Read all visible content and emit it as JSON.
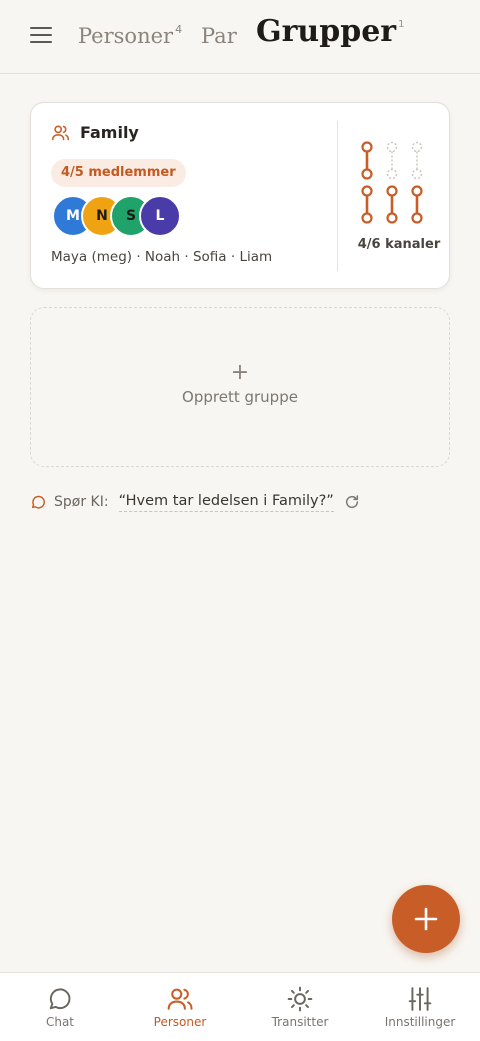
{
  "header": {
    "tabs": [
      {
        "label": "Personer",
        "count": "4"
      },
      {
        "label": "Par",
        "count": ""
      },
      {
        "label": "Grupper",
        "count": "1"
      }
    ],
    "active_tab": "Grupper"
  },
  "group_card": {
    "name": "Family",
    "badge": "4/5 medlemmer",
    "avatars": [
      {
        "initial": "M",
        "color": "#2f7ad6"
      },
      {
        "initial": "N",
        "color": "#f0a312"
      },
      {
        "initial": "S",
        "color": "#1fa36a"
      },
      {
        "initial": "L",
        "color": "#4a3ca8"
      }
    ],
    "members": "Maya (meg) · Noah · Sofia · Liam",
    "channels_label": "4/6 kanaler",
    "channels_filled": 4,
    "channels_total": 6
  },
  "create_group": {
    "plus": "+",
    "label": "Opprett gruppe"
  },
  "ask_ai": {
    "label": "Spør KI:",
    "query": "“Hvem tar ledelsen i Family?”"
  },
  "bottom_nav": [
    {
      "label": "Chat",
      "icon": "chat-icon"
    },
    {
      "label": "Personer",
      "icon": "people-icon"
    },
    {
      "label": "Transitter",
      "icon": "sun-icon"
    },
    {
      "label": "Innstillinger",
      "icon": "sliders-icon"
    }
  ],
  "active_nav": "Personer",
  "colors": {
    "accent": "#c95d28",
    "background": "#f8f6f2"
  }
}
